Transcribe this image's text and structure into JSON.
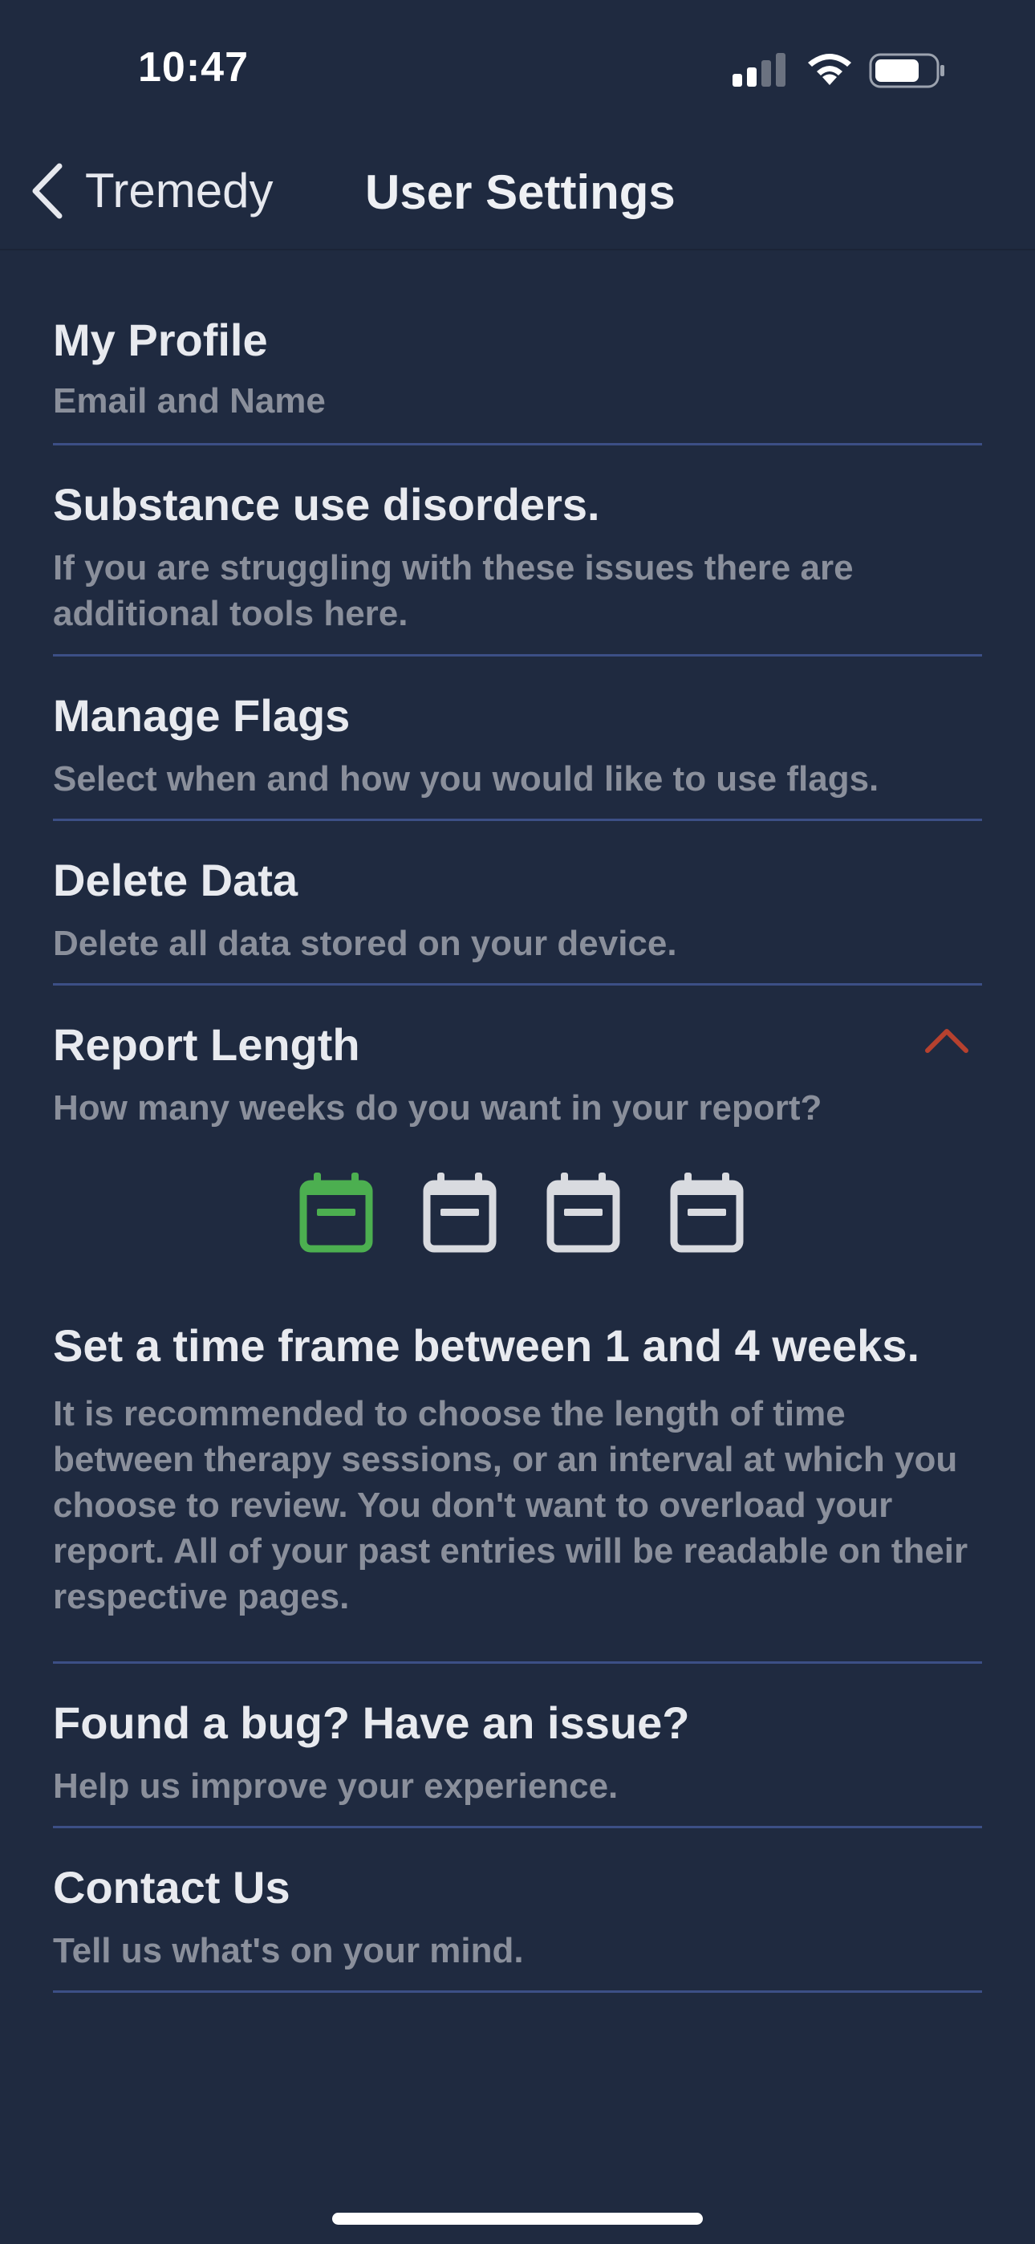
{
  "status_bar": {
    "time": "10:47"
  },
  "nav": {
    "back_label": "Tremedy",
    "title": "User Settings"
  },
  "settings": [
    {
      "title": "My Profile",
      "subtitle": "Email and Name"
    },
    {
      "title": "Substance use disorders.",
      "subtitle": "If you are struggling with these issues there are additional tools here."
    },
    {
      "title": "Manage Flags",
      "subtitle": "Select when and how you would like to use flags."
    },
    {
      "title": "Delete Data",
      "subtitle": "Delete all data stored on your device."
    },
    {
      "title": "Report Length",
      "subtitle": "How many weeks do you want in your report?",
      "expanded": true,
      "week_options": [
        1,
        2,
        3,
        4
      ],
      "selected_weeks": 1,
      "heading": "Set a time frame between 1 and 4 weeks.",
      "description": "It is recommended to choose the length of time between therapy sessions, or an interval at which you choose to review. You don't want to overload your report. All of your past entries will be readable on their respective pages."
    },
    {
      "title": "Found a bug? Have an issue?",
      "subtitle": "Help us improve your experience."
    },
    {
      "title": "Contact Us",
      "subtitle": "Tell us what's on your mind."
    }
  ],
  "colors": {
    "background": "#1f2a40",
    "divider": "#3c4f86",
    "selected": "#4caf50",
    "unselected": "#d9dbe0",
    "collapse_chevron": "#c0392b"
  },
  "icons": {
    "back": "chevron-left-icon",
    "collapse": "chevron-up-icon",
    "week": "calendar-icon"
  }
}
